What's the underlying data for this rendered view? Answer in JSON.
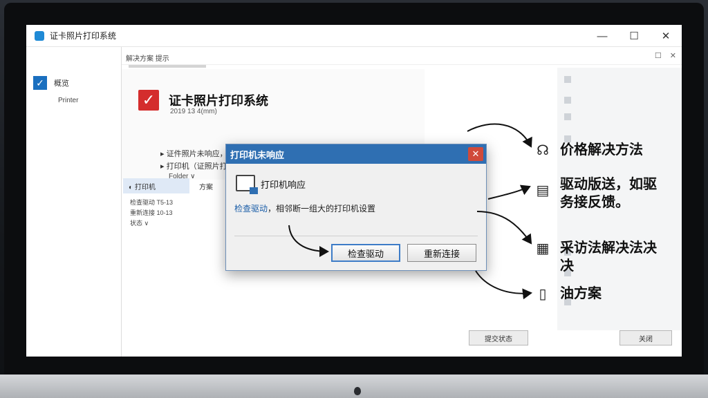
{
  "window": {
    "title": "证卡照片打印系统",
    "controls": [
      "—",
      "☐",
      "✕"
    ]
  },
  "sidebar": {
    "item_label": "概览",
    "sub_label": "Printer"
  },
  "toolbar": {
    "text": "解决方案 提示",
    "right_icons": [
      "☐",
      "✕"
    ]
  },
  "content": {
    "heading": "证卡照片打印系统",
    "subheading": "2019 13 4(mm)",
    "bullets": [
      "证件照片未响应，打印机响应度",
      "打印机（证照片打印系统"
    ],
    "folder": "Folder ∨"
  },
  "tabs": [
    "打印机",
    "方案"
  ],
  "list_items": [
    "检查驱动 T5-13",
    "重新连接 10-13",
    "状态 ∨"
  ],
  "dialog": {
    "title": "打印机未响应",
    "close_glyph": "✕",
    "heading": "打印机响应",
    "message_link": "检查驱动",
    "message_rest": "，相邻断一组大的打印机设置",
    "btn_check": "检查驱动",
    "btn_reconnect": "重新连接"
  },
  "bottom_buttons": [
    "提交状态",
    "关闭"
  ],
  "annotations": [
    {
      "icon": "headset-icon",
      "glyph": "☊",
      "text": "价格解决方法"
    },
    {
      "icon": "printer-icon",
      "glyph": "▤",
      "text": "驱动版送，如驱\n务接反馈。"
    },
    {
      "icon": "layout-icon",
      "glyph": "▦",
      "text": "采访法解决法决\n决"
    },
    {
      "icon": "document-icon",
      "glyph": "▯",
      "text": "油方案"
    }
  ]
}
